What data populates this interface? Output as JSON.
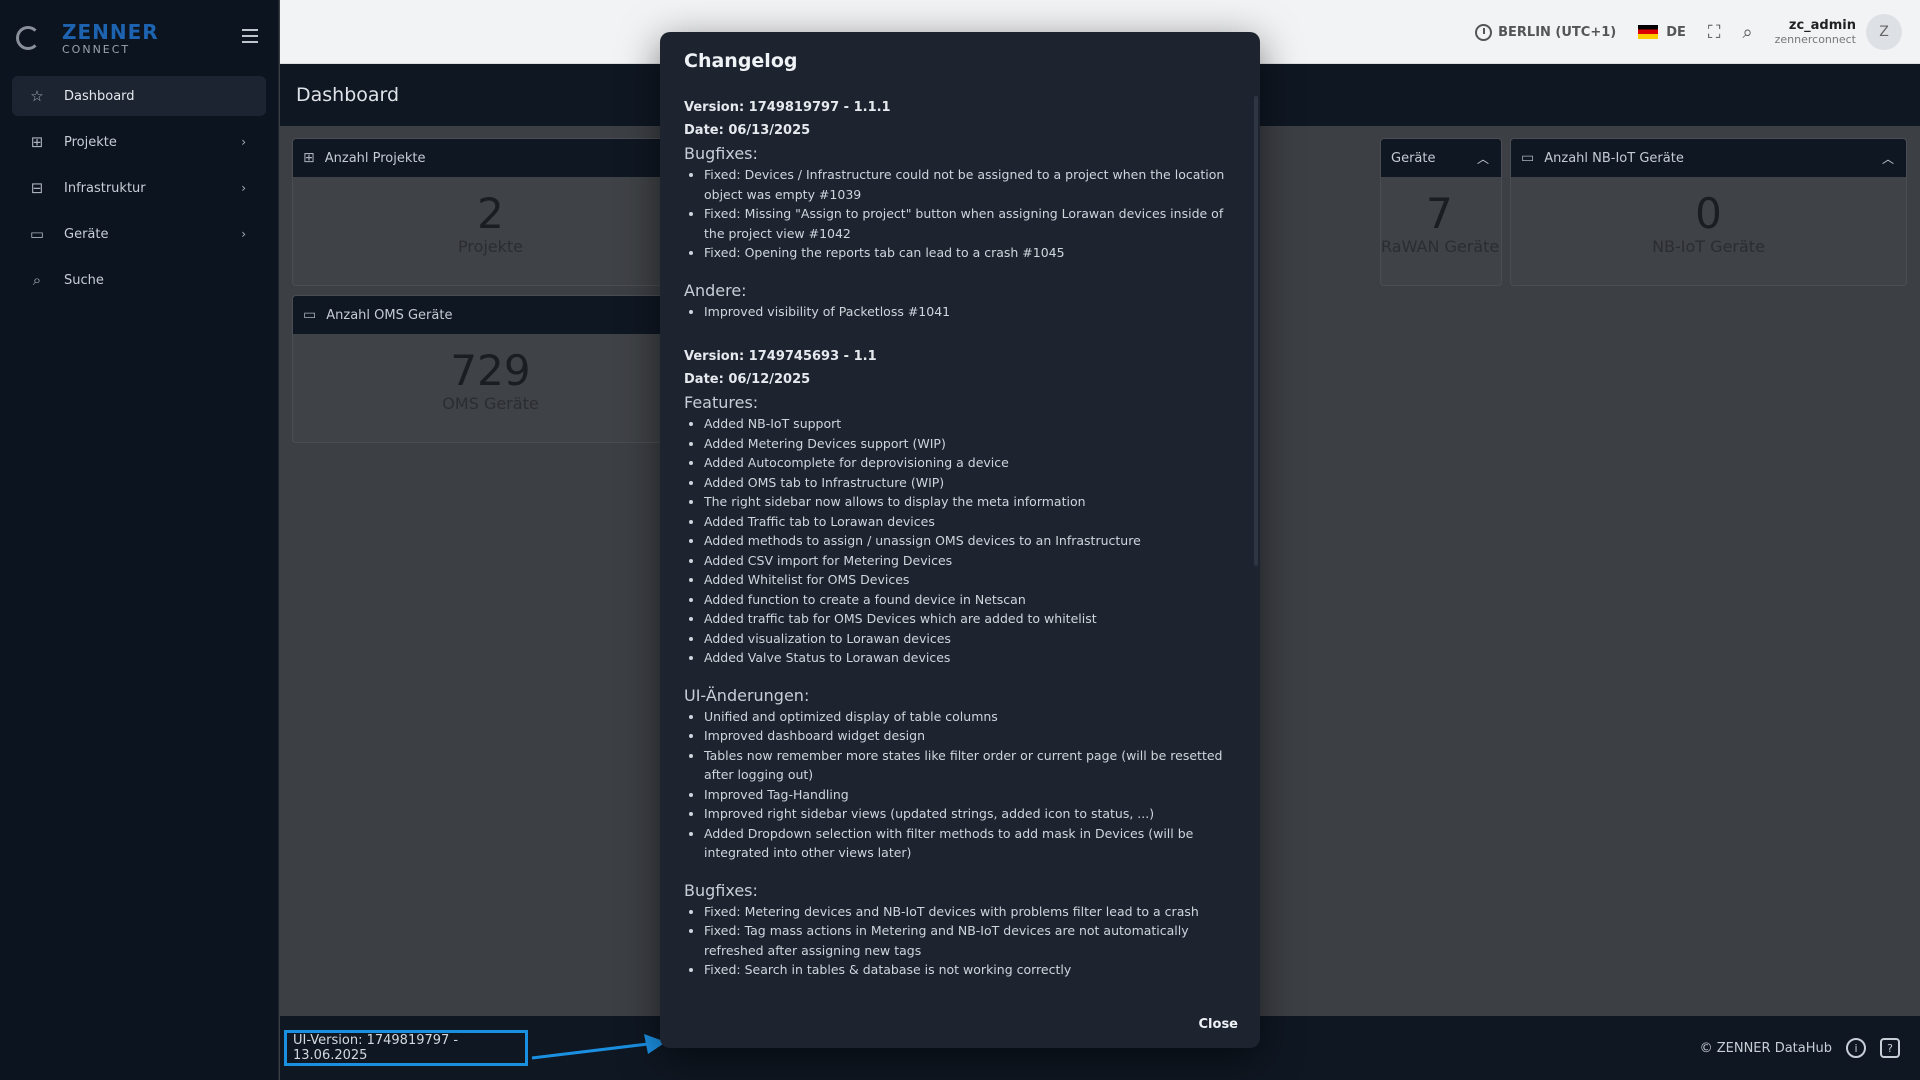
{
  "brand": {
    "name": "ZENNER",
    "sub": "CONNECT"
  },
  "sidebar": {
    "items": [
      {
        "label": "Dashboard"
      },
      {
        "label": "Projekte"
      },
      {
        "label": "Infrastruktur"
      },
      {
        "label": "Geräte"
      },
      {
        "label": "Suche"
      }
    ]
  },
  "topbar": {
    "timezone": "BERLIN (UTC+1)",
    "language": "DE",
    "user_name": "zc_admin",
    "user_org": "zennerconnect",
    "avatar_letter": "Z"
  },
  "page": {
    "title": "Dashboard"
  },
  "cards": [
    {
      "title": "Anzahl Projekte",
      "value": "2",
      "label": "Projekte"
    },
    {
      "title": "Geräte",
      "value": "7",
      "label": "RaWAN Geräte"
    },
    {
      "title": "Anzahl NB-IoT Geräte",
      "value": "0",
      "label": "NB-IoT Geräte"
    },
    {
      "title": "Anzahl OMS Geräte",
      "value": "729",
      "label": "OMS Geräte"
    }
  ],
  "footer": {
    "ui_version": "UI-Version: 1749819797 - 13.06.2025",
    "copyright": "© ZENNER DataHub",
    "highlight_color": "#1b8fe0"
  },
  "modal": {
    "title": "Changelog",
    "close_label": "Close",
    "v1": {
      "version": "Version: 1749819797 - 1.1.1",
      "date": "Date: 06/13/2025",
      "bugfixes_title": "Bugfixes:",
      "bugfixes": [
        "Fixed: Devices / Infrastructure could not be assigned to a project when the location object was empty #1039",
        "Fixed: Missing \"Assign to project\" button when assigning Lorawan devices inside of the project view #1042",
        "Fixed: Opening the reports tab can lead to a crash #1045"
      ],
      "other_title": "Andere:",
      "other": [
        "Improved visibility of Packetloss #1041"
      ]
    },
    "v2": {
      "version": "Version: 1749745693 - 1.1",
      "date": "Date: 06/12/2025",
      "features_title": "Features:",
      "features": [
        "Added NB-IoT support",
        "Added Metering Devices support (WIP)",
        "Added Autocomplete for deprovisioning a device",
        "Added OMS tab to Infrastructure (WIP)",
        "The right sidebar now allows to display the meta information",
        "Added Traffic tab to Lorawan devices",
        "Added methods to assign / unassign OMS devices to an Infrastructure",
        "Added CSV import for Metering Devices",
        "Added Whitelist for OMS Devices",
        "Added function to create a found device in Netscan",
        "Added traffic tab for OMS Devices which are added to whitelist",
        "Added visualization to Lorawan devices",
        "Added Valve Status to Lorawan devices"
      ],
      "ui_title": "UI-Änderungen:",
      "ui": [
        "Unified and optimized display of table columns",
        "Improved dashboard widget design",
        "Tables now remember more states like filter order or current page (will be resetted after logging out)",
        "Improved Tag-Handling",
        "Improved right sidebar views (updated strings, added icon to status, ...)",
        "Added Dropdown selection with filter methods to add mask in Devices (will be integrated into other views later)"
      ],
      "bugfixes_title": "Bugfixes:",
      "bugfixes": [
        "Fixed: Metering devices and NB-IoT devices with problems filter lead to a crash",
        "Fixed: Tag mass actions in Metering and NB-IoT devices are not automatically refreshed after assigning new tags",
        "Fixed: Search in tables & database is not working correctly"
      ]
    }
  }
}
